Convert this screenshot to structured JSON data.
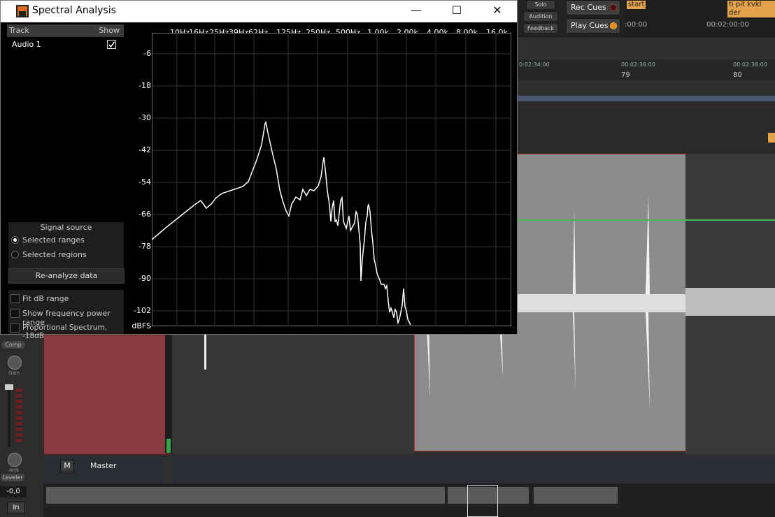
{
  "window": {
    "title": "Spectral Analysis"
  },
  "panel": {
    "track_header": "Track",
    "show_header": "Show",
    "tracks": [
      {
        "name": "Audio 1",
        "show": true
      }
    ],
    "signal_source_label": "Signal source",
    "sources": [
      {
        "label": "Selected ranges",
        "selected": true
      },
      {
        "label": "Selected regions",
        "selected": false
      }
    ],
    "reanalyze_label": "Re-analyze data",
    "options": [
      {
        "label": "Fit dB range",
        "checked": false
      },
      {
        "label": "Show frequency power range",
        "checked": false
      },
      {
        "label": "Proportional Spectrum, -18dB",
        "checked": false
      }
    ]
  },
  "graph": {
    "freq_labels": [
      "10Hz",
      "16Hz",
      "25Hz",
      "39Hz",
      "62Hz",
      "125Hz",
      "250Hz",
      "500Hz",
      "1.00k",
      "2.00k",
      "4.00k",
      "8.00k",
      "16.0k"
    ],
    "db_labels": [
      "-6",
      "-18",
      "-30",
      "-42",
      "-54",
      "-66",
      "-78",
      "-90",
      "-102"
    ],
    "unit_label": "dBFS"
  },
  "daw": {
    "solo": "Solo",
    "audition": "Audition",
    "feedback": "Feedback",
    "rec_cues": "Rec Cues",
    "play_cues": "Play Cues",
    "marker_start": "start",
    "marker_end": "ti pit kvkl der",
    "time_left": ":00:00",
    "time_right": "00:02:00:00",
    "ruler_times": [
      "0:02:34:00",
      "00:02:36:00",
      "00:02:38:00"
    ],
    "bars": [
      "79",
      "80"
    ],
    "master_label": "Master",
    "mute_btn": "M",
    "comp_btn": "Comp",
    "gain_label": "Gain",
    "attk_label": "Attk",
    "leveler_label": "Leveler",
    "value_readout": "-0,0",
    "in_btn": "In"
  }
}
